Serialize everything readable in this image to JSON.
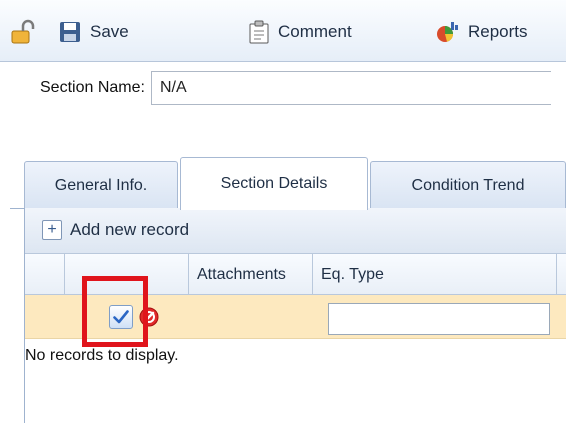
{
  "toolbar": {
    "lock_icon": "unlock-icon",
    "save_label": "Save",
    "comment_label": "Comment",
    "reports_label": "Reports"
  },
  "section": {
    "label": "Section Name:",
    "value": "N/A"
  },
  "tabs": [
    {
      "label": "General Info.",
      "active": false
    },
    {
      "label": "Section Details",
      "active": true
    },
    {
      "label": "Condition Trend",
      "active": false
    }
  ],
  "grid": {
    "add_label": "Add new record",
    "columns": [
      "",
      "",
      "Attachments",
      "Eq. Type"
    ],
    "edit_row": {
      "eq_type_value": ""
    },
    "empty_message": "No records to display."
  },
  "colors": {
    "highlight": "#e0141c",
    "edit_row_bg": "#fde9bf",
    "accent": "#1f2f45"
  }
}
